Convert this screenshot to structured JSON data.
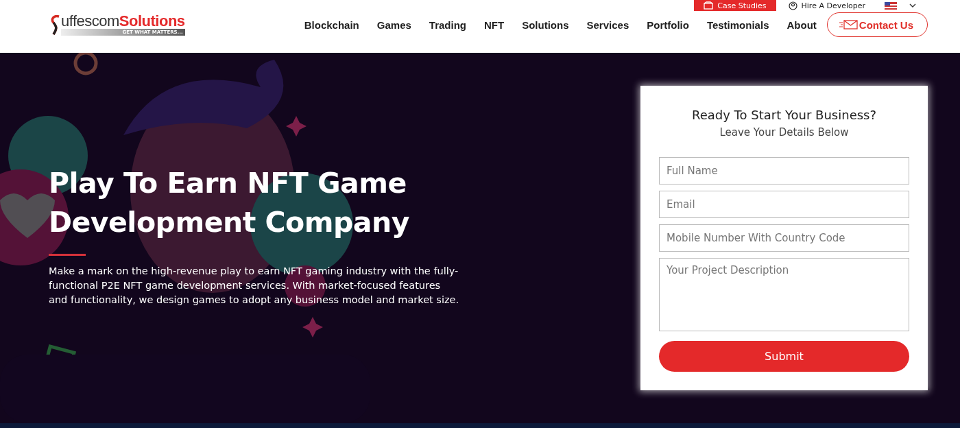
{
  "top_bar": {
    "links": [
      {
        "kind": "highlight",
        "label": "Case Studies"
      },
      {
        "kind": "plain",
        "label": "Hire A Developer"
      }
    ]
  },
  "logo": {
    "brand_dark": "uffescom",
    "brand_accent": "Solutions",
    "tagline": "GET WHAT MATTERS..."
  },
  "nav": {
    "items": [
      "Blockchain",
      "Games",
      "Trading",
      "NFT",
      "Solutions",
      "Services",
      "Portfolio",
      "Testimonials",
      "About"
    ],
    "cta": "Contact Us"
  },
  "hero": {
    "title": "Play To Earn NFT Game Development Company",
    "description": "Make a mark on the high-revenue play to earn NFT gaming industry with the fully-functional P2E NFT game development services. With market-focused features and functionality, we design games to adopt any business model and market size."
  },
  "form": {
    "title": "Ready To Start Your Business?",
    "subtitle": "Leave Your Details Below",
    "fields": [
      {
        "kind": "input",
        "placeholder": "Full Name"
      },
      {
        "kind": "input",
        "placeholder": "Email"
      },
      {
        "kind": "input",
        "placeholder": "Mobile Number With Country Code"
      },
      {
        "kind": "textarea",
        "placeholder": "Your Project Description"
      }
    ],
    "submit": "Submit"
  }
}
